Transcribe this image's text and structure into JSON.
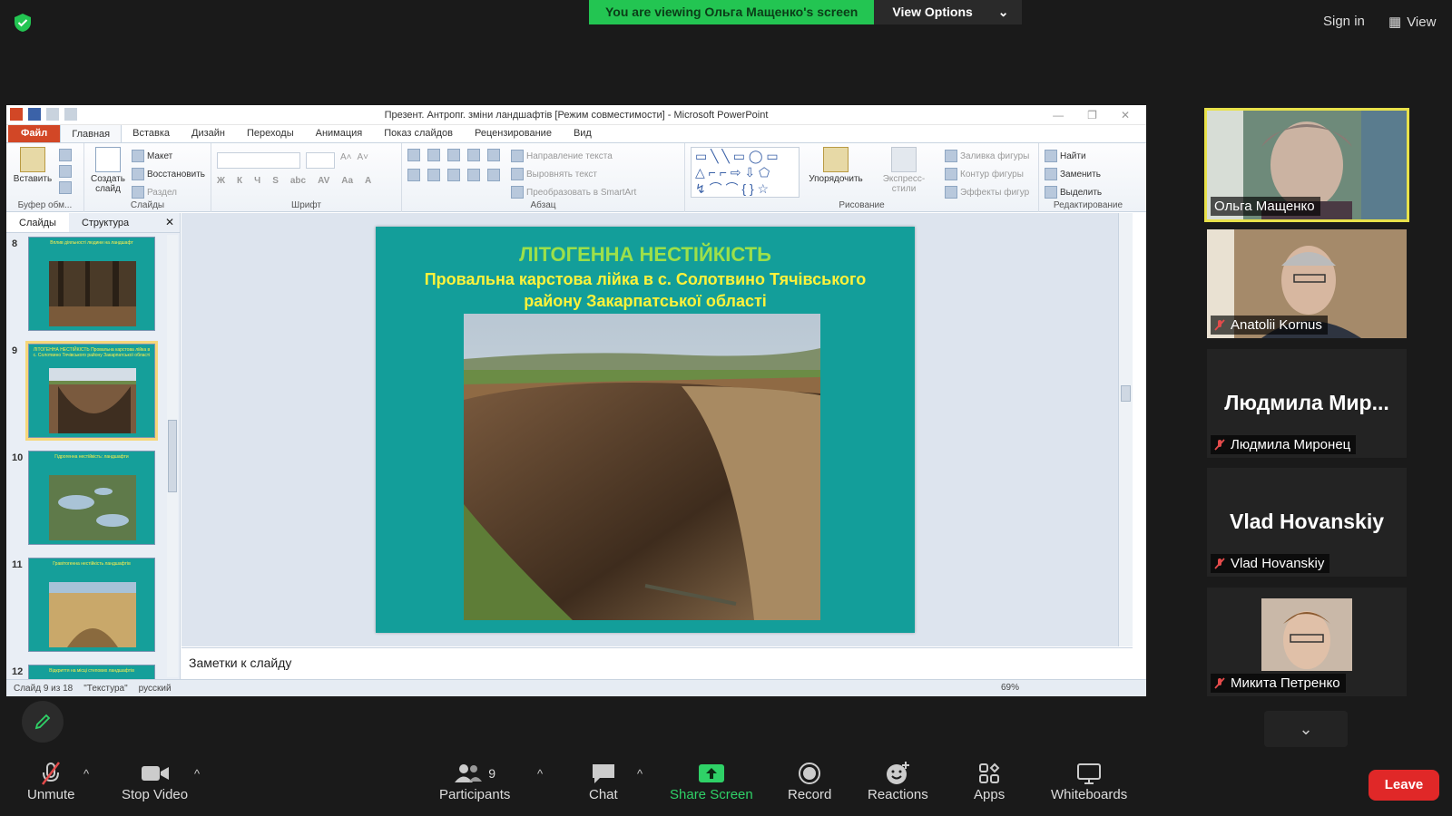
{
  "topbar": {
    "banner_text": "You are viewing Ольга Мащенко's screen",
    "view_options": "View Options",
    "sign_in": "Sign in",
    "view": "View",
    "shield_icon": "shield-check-icon"
  },
  "ppt": {
    "title": "Презент. Антропг. зміни ландшафтів [Режим совместимости] - Microsoft PowerPoint",
    "tabs": [
      "Файл",
      "Главная",
      "Вставка",
      "Дизайн",
      "Переходы",
      "Анимация",
      "Показ слайдов",
      "Рецензирование",
      "Вид"
    ],
    "ribbon": {
      "paste": "Вставить",
      "clipboard_group": "Буфер обм...",
      "new_slide": "Создать слайд",
      "layout": "Макет",
      "reset": "Восстановить",
      "section": "Раздел",
      "slides_group": "Слайды",
      "font_group": "Шрифт",
      "text_direction": "Направление текста",
      "align_text": "Выровнять текст",
      "smartart": "Преобразовать в SmartArt",
      "paragraph_group": "Абзац",
      "arrange": "Упорядочить",
      "quick_styles": "Экспресс-стили",
      "shape_fill": "Заливка фигуры",
      "shape_outline": "Контур фигуры",
      "shape_effects": "Эффекты фигур",
      "drawing_group": "Рисование",
      "find": "Найти",
      "replace": "Заменить",
      "select": "Выделить",
      "editing_group": "Редактирование"
    },
    "pane_tabs": [
      "Слайды",
      "Структура"
    ],
    "thumbnails": [
      {
        "num": "8",
        "title": "Вплив діяльності людини на ландшафт"
      },
      {
        "num": "9",
        "title": "ЛІТОГЕННА НЕСТІЙКІСТЬ Провальна карстова лійка в с. Солотвино Тячівського району Закарпатської області"
      },
      {
        "num": "10",
        "title": "Гідрогенна нестійкість: ландшафти"
      },
      {
        "num": "11",
        "title": "Гравітогенна нестійкість ландшафтів"
      },
      {
        "num": "12",
        "title": "Відкриття на місці степових ландшафтів"
      }
    ],
    "slide": {
      "heading": "ЛІТОГЕННА НЕСТІЙКІСТЬ",
      "subtitle": "Провальна карстова лійка в с. Солотвино Тячівського району Закарпатської області"
    },
    "notes_placeholder": "Заметки к слайду",
    "status": {
      "slide_info": "Слайд 9 из 18",
      "theme": "\"Текстура\"",
      "language": "русский",
      "zoom": "69%"
    }
  },
  "participants": [
    {
      "name": "Ольга Мащенко",
      "video": true,
      "speaker": true
    },
    {
      "name": "Anatolii Kornus",
      "video": true,
      "muted": true
    },
    {
      "name": "Людмила Миронец",
      "display": "Людмила  Мир...",
      "video": false,
      "muted": true
    },
    {
      "name": "Vlad Hovanskiy",
      "display": "Vlad Hovanskiy",
      "video": false,
      "muted": true
    },
    {
      "name": "Микита Петренко",
      "video": true,
      "muted": true
    }
  ],
  "toolbar": {
    "unmute": "Unmute",
    "stop_video": "Stop Video",
    "participants": "Participants",
    "participants_count": "9",
    "chat": "Chat",
    "share_screen": "Share Screen",
    "record": "Record",
    "reactions": "Reactions",
    "apps": "Apps",
    "whiteboards": "Whiteboards",
    "leave": "Leave"
  },
  "colors": {
    "zoom_green": "#23c552",
    "slide_teal": "#139e9a",
    "leave_red": "#e02828",
    "speaker_outline": "#e8e14a"
  }
}
